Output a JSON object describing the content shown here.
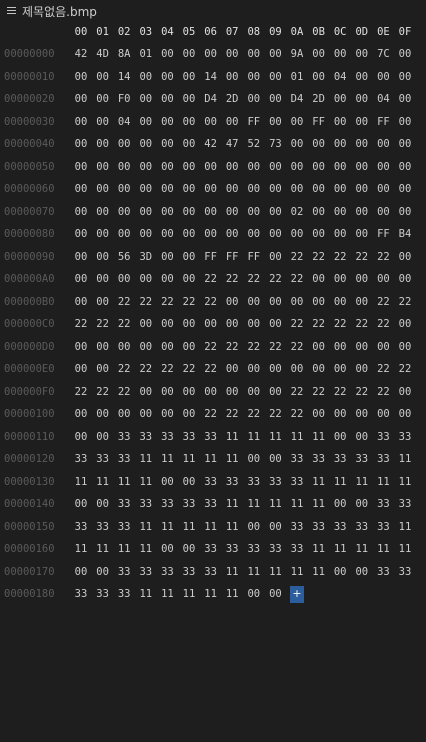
{
  "breadcrumb": {
    "file_icon": "lines-icon",
    "filename": "제목없음.bmp"
  },
  "columns": [
    "00",
    "01",
    "02",
    "03",
    "04",
    "05",
    "06",
    "07",
    "08",
    "09",
    "0A",
    "0B",
    "0C",
    "0D",
    "0E",
    "0F"
  ],
  "rows": [
    {
      "offset": "00000000",
      "bytes": [
        "42",
        "4D",
        "8A",
        "01",
        "00",
        "00",
        "00",
        "00",
        "00",
        "00",
        "9A",
        "00",
        "00",
        "00",
        "7C",
        "00"
      ]
    },
    {
      "offset": "00000010",
      "bytes": [
        "00",
        "00",
        "14",
        "00",
        "00",
        "00",
        "14",
        "00",
        "00",
        "00",
        "01",
        "00",
        "04",
        "00",
        "00",
        "00"
      ]
    },
    {
      "offset": "00000020",
      "bytes": [
        "00",
        "00",
        "F0",
        "00",
        "00",
        "00",
        "D4",
        "2D",
        "00",
        "00",
        "D4",
        "2D",
        "00",
        "00",
        "04",
        "00"
      ]
    },
    {
      "offset": "00000030",
      "bytes": [
        "00",
        "00",
        "04",
        "00",
        "00",
        "00",
        "00",
        "00",
        "FF",
        "00",
        "00",
        "FF",
        "00",
        "00",
        "FF",
        "00"
      ]
    },
    {
      "offset": "00000040",
      "bytes": [
        "00",
        "00",
        "00",
        "00",
        "00",
        "00",
        "42",
        "47",
        "52",
        "73",
        "00",
        "00",
        "00",
        "00",
        "00",
        "00"
      ]
    },
    {
      "offset": "00000050",
      "bytes": [
        "00",
        "00",
        "00",
        "00",
        "00",
        "00",
        "00",
        "00",
        "00",
        "00",
        "00",
        "00",
        "00",
        "00",
        "00",
        "00"
      ]
    },
    {
      "offset": "00000060",
      "bytes": [
        "00",
        "00",
        "00",
        "00",
        "00",
        "00",
        "00",
        "00",
        "00",
        "00",
        "00",
        "00",
        "00",
        "00",
        "00",
        "00"
      ]
    },
    {
      "offset": "00000070",
      "bytes": [
        "00",
        "00",
        "00",
        "00",
        "00",
        "00",
        "00",
        "00",
        "00",
        "00",
        "02",
        "00",
        "00",
        "00",
        "00",
        "00"
      ]
    },
    {
      "offset": "00000080",
      "bytes": [
        "00",
        "00",
        "00",
        "00",
        "00",
        "00",
        "00",
        "00",
        "00",
        "00",
        "00",
        "00",
        "00",
        "00",
        "FF",
        "B4"
      ]
    },
    {
      "offset": "00000090",
      "bytes": [
        "00",
        "00",
        "56",
        "3D",
        "00",
        "00",
        "FF",
        "FF",
        "FF",
        "00",
        "22",
        "22",
        "22",
        "22",
        "22",
        "00"
      ]
    },
    {
      "offset": "000000A0",
      "bytes": [
        "00",
        "00",
        "00",
        "00",
        "00",
        "00",
        "22",
        "22",
        "22",
        "22",
        "22",
        "00",
        "00",
        "00",
        "00",
        "00"
      ]
    },
    {
      "offset": "000000B0",
      "bytes": [
        "00",
        "00",
        "22",
        "22",
        "22",
        "22",
        "22",
        "00",
        "00",
        "00",
        "00",
        "00",
        "00",
        "00",
        "22",
        "22"
      ]
    },
    {
      "offset": "000000C0",
      "bytes": [
        "22",
        "22",
        "22",
        "00",
        "00",
        "00",
        "00",
        "00",
        "00",
        "00",
        "22",
        "22",
        "22",
        "22",
        "22",
        "00"
      ]
    },
    {
      "offset": "000000D0",
      "bytes": [
        "00",
        "00",
        "00",
        "00",
        "00",
        "00",
        "22",
        "22",
        "22",
        "22",
        "22",
        "00",
        "00",
        "00",
        "00",
        "00"
      ]
    },
    {
      "offset": "000000E0",
      "bytes": [
        "00",
        "00",
        "22",
        "22",
        "22",
        "22",
        "22",
        "00",
        "00",
        "00",
        "00",
        "00",
        "00",
        "00",
        "22",
        "22"
      ]
    },
    {
      "offset": "000000F0",
      "bytes": [
        "22",
        "22",
        "22",
        "00",
        "00",
        "00",
        "00",
        "00",
        "00",
        "00",
        "22",
        "22",
        "22",
        "22",
        "22",
        "00"
      ]
    },
    {
      "offset": "00000100",
      "bytes": [
        "00",
        "00",
        "00",
        "00",
        "00",
        "00",
        "22",
        "22",
        "22",
        "22",
        "22",
        "00",
        "00",
        "00",
        "00",
        "00"
      ]
    },
    {
      "offset": "00000110",
      "bytes": [
        "00",
        "00",
        "33",
        "33",
        "33",
        "33",
        "33",
        "11",
        "11",
        "11",
        "11",
        "11",
        "00",
        "00",
        "33",
        "33"
      ]
    },
    {
      "offset": "00000120",
      "bytes": [
        "33",
        "33",
        "33",
        "11",
        "11",
        "11",
        "11",
        "11",
        "00",
        "00",
        "33",
        "33",
        "33",
        "33",
        "33",
        "11"
      ]
    },
    {
      "offset": "00000130",
      "bytes": [
        "11",
        "11",
        "11",
        "11",
        "00",
        "00",
        "33",
        "33",
        "33",
        "33",
        "33",
        "11",
        "11",
        "11",
        "11",
        "11"
      ]
    },
    {
      "offset": "00000140",
      "bytes": [
        "00",
        "00",
        "33",
        "33",
        "33",
        "33",
        "33",
        "11",
        "11",
        "11",
        "11",
        "11",
        "00",
        "00",
        "33",
        "33"
      ]
    },
    {
      "offset": "00000150",
      "bytes": [
        "33",
        "33",
        "33",
        "11",
        "11",
        "11",
        "11",
        "11",
        "00",
        "00",
        "33",
        "33",
        "33",
        "33",
        "33",
        "11"
      ]
    },
    {
      "offset": "00000160",
      "bytes": [
        "11",
        "11",
        "11",
        "11",
        "00",
        "00",
        "33",
        "33",
        "33",
        "33",
        "33",
        "11",
        "11",
        "11",
        "11",
        "11"
      ]
    },
    {
      "offset": "00000170",
      "bytes": [
        "00",
        "00",
        "33",
        "33",
        "33",
        "33",
        "33",
        "11",
        "11",
        "11",
        "11",
        "11",
        "00",
        "00",
        "33",
        "33"
      ]
    },
    {
      "offset": "00000180",
      "bytes": [
        "33",
        "33",
        "33",
        "11",
        "11",
        "11",
        "11",
        "11",
        "00",
        "00"
      ]
    }
  ],
  "append_cell": {
    "label": "+"
  },
  "colors": {
    "background": "#1e1e1e",
    "offset_text": "#5a5a5a",
    "byte_text": "#cccccc",
    "header_text": "#e0e0e0",
    "append_cell_bg": "#2c5d9c"
  }
}
